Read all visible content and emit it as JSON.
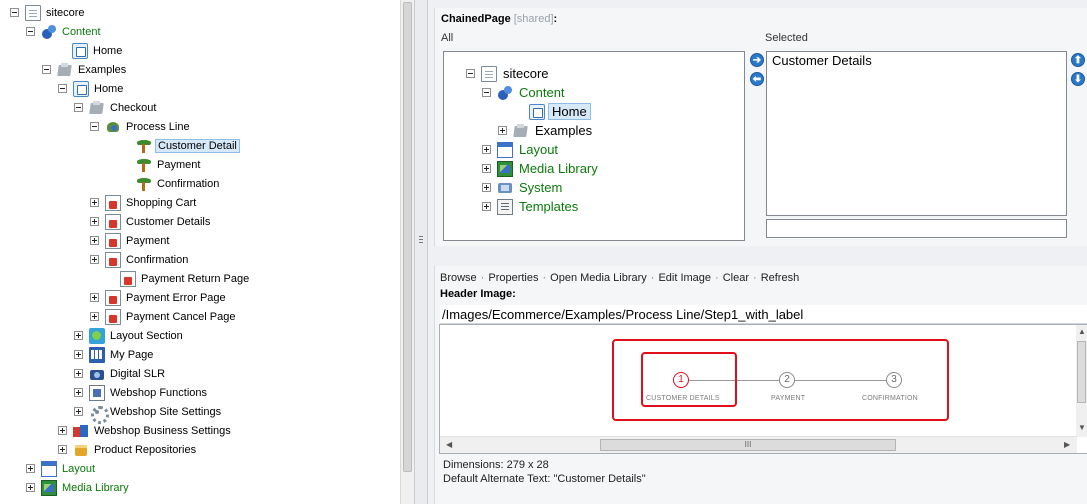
{
  "content_tree": [
    {
      "label": "sitecore",
      "icon": "page-icon",
      "expander": "minus",
      "green": false
    },
    {
      "label": "Content",
      "icon": "content-icon",
      "expander": "minus",
      "green": true
    },
    {
      "label": "Home",
      "icon": "home-icon",
      "expander": "none",
      "green": false
    },
    {
      "label": "Examples",
      "icon": "folder-icon",
      "expander": "minus",
      "green": false
    },
    {
      "label": "Home",
      "icon": "home-icon",
      "expander": "minus",
      "green": false
    },
    {
      "label": "Checkout",
      "icon": "folder-icon",
      "expander": "minus",
      "green": false
    },
    {
      "label": "Process Line",
      "icon": "process-line-icon",
      "expander": "minus",
      "green": false
    },
    {
      "label": "Customer Detail",
      "icon": "process-step-icon",
      "expander": "none",
      "green": false,
      "selected": true
    },
    {
      "label": "Payment",
      "icon": "process-step-icon",
      "expander": "none",
      "green": false
    },
    {
      "label": "Confirmation",
      "icon": "process-step-icon",
      "expander": "none",
      "green": false
    },
    {
      "label": "Shopping Cart",
      "icon": "red-page-icon",
      "expander": "plus",
      "green": false
    },
    {
      "label": "Customer Details",
      "icon": "red-page-icon",
      "expander": "plus",
      "green": false
    },
    {
      "label": "Payment",
      "icon": "red-page-icon",
      "expander": "plus",
      "green": false
    },
    {
      "label": "Confirmation",
      "icon": "red-page-icon",
      "expander": "plus",
      "green": false
    },
    {
      "label": "Payment Return Page",
      "icon": "red-page-icon",
      "expander": "none",
      "green": false
    },
    {
      "label": "Payment Error Page",
      "icon": "red-page-icon",
      "expander": "plus",
      "green": false
    },
    {
      "label": "Payment Cancel Page",
      "icon": "red-page-icon",
      "expander": "plus",
      "green": false
    },
    {
      "label": "Layout Section",
      "icon": "layout-section-icon",
      "expander": "plus",
      "green": false
    },
    {
      "label": "My Page",
      "icon": "my-page-icon",
      "expander": "plus",
      "green": false
    },
    {
      "label": "Digital SLR",
      "icon": "camera-icon",
      "expander": "plus",
      "green": false
    },
    {
      "label": "Webshop Functions",
      "icon": "functions-icon",
      "expander": "plus",
      "green": false
    },
    {
      "label": "Webshop Site Settings",
      "icon": "gear-icon",
      "expander": "plus",
      "green": false
    },
    {
      "label": "Webshop Business Settings",
      "icon": "business-icon",
      "expander": "plus",
      "green": false
    },
    {
      "label": "Product Repositories",
      "icon": "repository-icon",
      "expander": "plus",
      "green": false
    },
    {
      "label": "Layout",
      "icon": "layout-icon",
      "expander": "plus",
      "green": true
    },
    {
      "label": "Media Library",
      "icon": "media-library-icon",
      "expander": "plus",
      "green": true
    }
  ],
  "chained_page": {
    "title": "ChainedPage",
    "shared_tag": "[shared]",
    "colon": ":",
    "all_caption": "All",
    "selected_caption": "Selected",
    "all_tree": [
      {
        "label": "sitecore",
        "icon": "page-icon",
        "expander": "minus",
        "green": false
      },
      {
        "label": "Content",
        "icon": "content-icon",
        "expander": "minus",
        "green": true
      },
      {
        "label": "Home",
        "icon": "home-icon",
        "expander": "none",
        "green": false,
        "selected": true
      },
      {
        "label": "Examples",
        "icon": "folder-icon",
        "expander": "plus",
        "green": false
      },
      {
        "label": "Layout",
        "icon": "layout-icon",
        "expander": "plus",
        "green": true
      },
      {
        "label": "Media Library",
        "icon": "media-library-icon",
        "expander": "plus",
        "green": true
      },
      {
        "label": "System",
        "icon": "system-icon",
        "expander": "plus",
        "green": true
      },
      {
        "label": "Templates",
        "icon": "templates-icon",
        "expander": "plus",
        "green": true
      }
    ],
    "selected_items": [
      "Customer Details"
    ],
    "add_arrow": "➔",
    "remove_arrow": "⬅",
    "up_arrow": "⬆",
    "down_arrow": "⬇",
    "filter_value": ""
  },
  "header_image": {
    "toolbar": [
      "Browse",
      "Properties",
      "Open Media Library",
      "Edit Image",
      "Clear",
      "Refresh"
    ],
    "separator": "·",
    "title": "Header Image:",
    "path": "/Images/Ecommerce/Examples/Process Line/Step1_with_label",
    "steps": [
      {
        "number": "1",
        "label": "CUSTOMER DETAILS",
        "active": true
      },
      {
        "number": "2",
        "label": "PAYMENT",
        "active": false
      },
      {
        "number": "3",
        "label": "CONFIRMATION",
        "active": false
      }
    ],
    "scroll_grip": "III",
    "dimensions": "Dimensions: 279 x 28",
    "alt_text": "Default Alternate Text: \"Customer Details\""
  },
  "colors": {
    "tree_green": "#0b7a0b",
    "highlight_red": "#e0101a",
    "selection_blue": "#d7e9f9"
  }
}
